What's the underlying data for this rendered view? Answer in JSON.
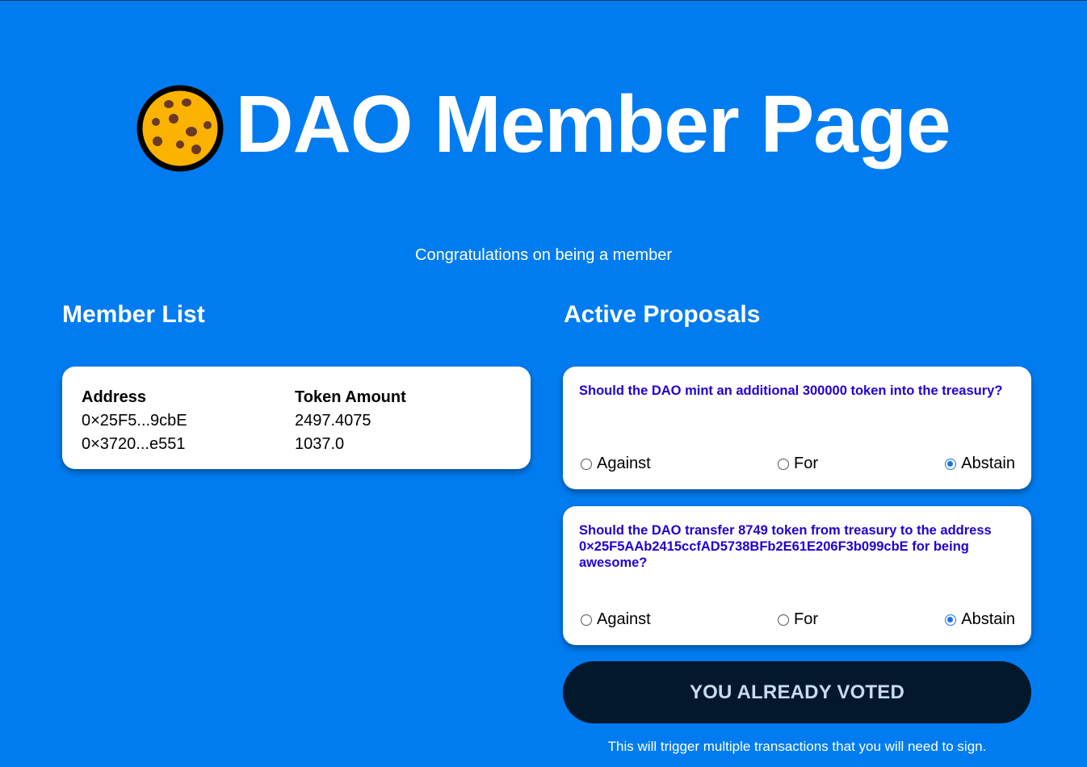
{
  "header": {
    "logo_icon": "cookie-icon",
    "title": "DAO Member Page",
    "subtitle": "Congratulations on being a member"
  },
  "member_list": {
    "heading": "Member List",
    "columns": [
      "Address",
      "Token Amount"
    ],
    "rows": [
      {
        "address": "0×25F5...9cbE",
        "amount": "2497.4075"
      },
      {
        "address": "0×3720...e551",
        "amount": "1037.0"
      }
    ]
  },
  "proposals": {
    "heading": "Active Proposals",
    "items": [
      {
        "text": "Should the DAO mint an additional 300000 token into the treasury?",
        "options": [
          "Against",
          "For",
          "Abstain"
        ],
        "selected": "Abstain"
      },
      {
        "text": "Should the DAO transfer 8749 token from treasury to the address 0×25F5AAb2415ccfAD5738BFb2E61E206F3b099cbE for being awesome?",
        "options": [
          "Against",
          "For",
          "Abstain"
        ],
        "selected": "Abstain"
      }
    ],
    "submit_label": "YOU ALREADY VOTED",
    "footnote": "This will trigger multiple transactions that you will need to sign."
  },
  "colors": {
    "background": "#007cf0",
    "card": "#ffffff",
    "proposal_text": "#1f00d6",
    "button": "#01182d",
    "radio_selected": "#1a73e8"
  }
}
